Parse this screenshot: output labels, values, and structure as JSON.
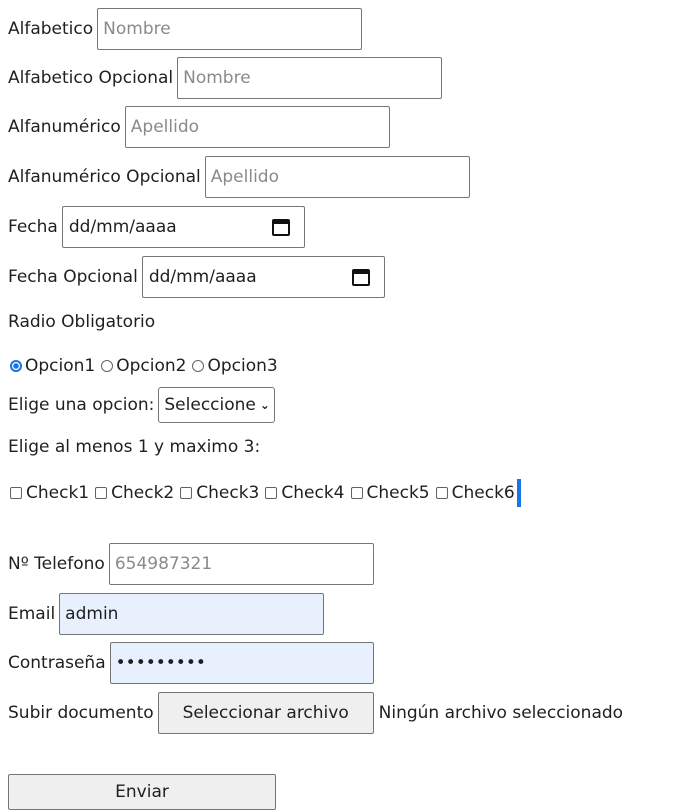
{
  "fields": {
    "alfabetico": {
      "label": "Alfabetico",
      "placeholder": "Nombre"
    },
    "alfabetico_opcional": {
      "label": "Alfabetico Opcional",
      "placeholder": "Nombre"
    },
    "alfanumerico": {
      "label": "Alfanumérico",
      "placeholder": "Apellido"
    },
    "alfanumerico_opcional": {
      "label": "Alfanumérico Opcional",
      "placeholder": "Apellido"
    },
    "fecha": {
      "label": "Fecha",
      "placeholder": "dd/mm/aaaa"
    },
    "fecha_opcional": {
      "label": "Fecha Opcional",
      "placeholder": "dd/mm/aaaa"
    },
    "telefono": {
      "label": "Nº Telefono",
      "placeholder": "654987321"
    },
    "email": {
      "label": "Email",
      "value": "admin"
    },
    "password": {
      "label": "Contraseña",
      "value": "•••••••••"
    }
  },
  "radio": {
    "heading": "Radio Obligatorio",
    "options": [
      "Opcion1",
      "Opcion2",
      "Opcion3"
    ],
    "selected": "Opcion1"
  },
  "select": {
    "label": "Elige una opcion:",
    "value": "Seleccione"
  },
  "checks": {
    "heading": "Elige al menos 1 y maximo 3:",
    "options": [
      "Check1",
      "Check2",
      "Check3",
      "Check4",
      "Check5",
      "Check6"
    ]
  },
  "file": {
    "label": "Subir documento",
    "button_label": "Seleccionar archivo",
    "status": "Ningún archivo seleccionado"
  },
  "submit": {
    "label": "Enviar"
  },
  "colors": {
    "accent": "#1a73e8",
    "autofill": "#e8f0fe",
    "button_bg": "#efefef"
  }
}
